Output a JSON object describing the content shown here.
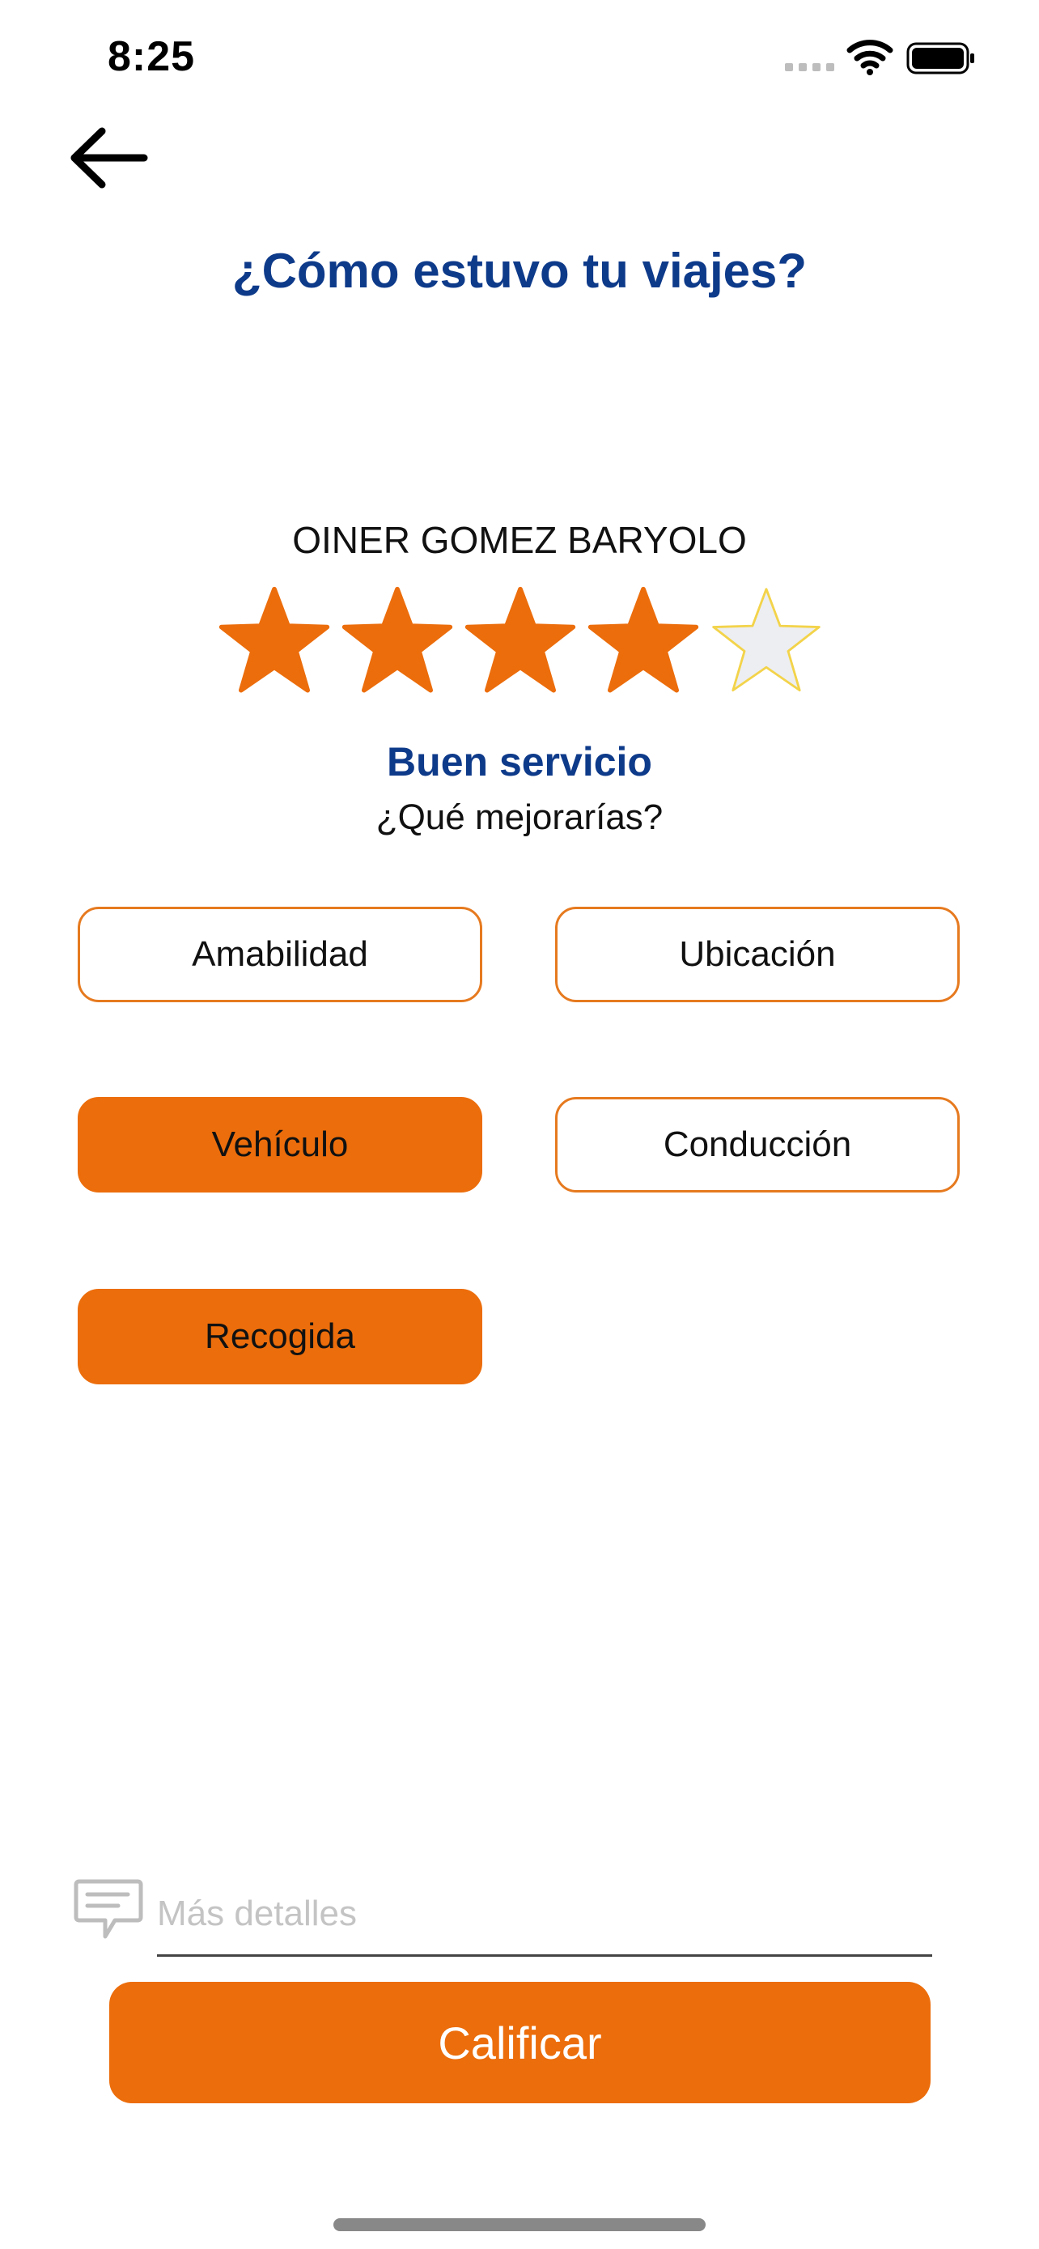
{
  "status_bar": {
    "time": "8:25"
  },
  "header": {
    "back_icon": "arrow-left-icon",
    "title": "¿Cómo estuvo tu viajes?"
  },
  "driver": {
    "name": "OINER GOMEZ BARYOLO"
  },
  "rating": {
    "value": 4,
    "max": 5,
    "filled_color": "#ec6d0b",
    "empty_color": "#eceef2",
    "label": "Buen servicio",
    "question": "¿Qué mejorarías?"
  },
  "improvements": [
    {
      "label": "Amabilidad",
      "selected": false
    },
    {
      "label": "Ubicación",
      "selected": false
    },
    {
      "label": "Vehículo",
      "selected": true
    },
    {
      "label": "Conducción",
      "selected": false
    },
    {
      "label": "Recogida",
      "selected": true
    }
  ],
  "details": {
    "icon": "chat-bubble-icon",
    "placeholder": "Más detalles",
    "value": ""
  },
  "submit": {
    "label": "Calificar"
  },
  "colors": {
    "accent": "#ec6d0b",
    "title": "#0e3a8a"
  }
}
